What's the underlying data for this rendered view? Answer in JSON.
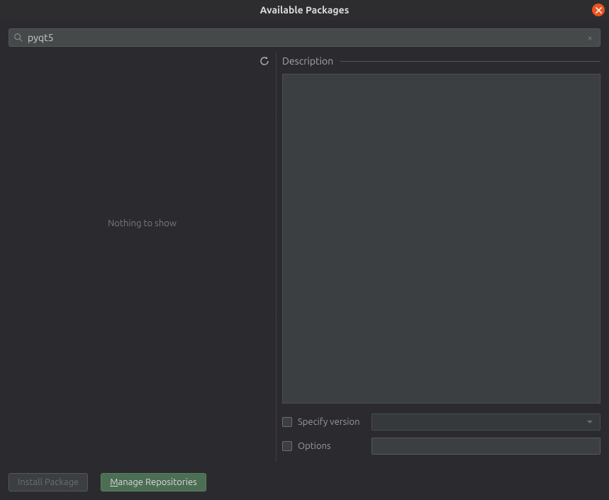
{
  "window": {
    "title": "Available Packages"
  },
  "search": {
    "value": "pyqt5"
  },
  "list": {
    "empty_message": "Nothing to show"
  },
  "details": {
    "description_label": "Description",
    "specify_version_label": "Specify version",
    "options_label": "Options",
    "version_value": "",
    "options_value": ""
  },
  "buttons": {
    "install": "Install Package",
    "manage_prefix": "M",
    "manage_rest": "anage Repositories"
  }
}
